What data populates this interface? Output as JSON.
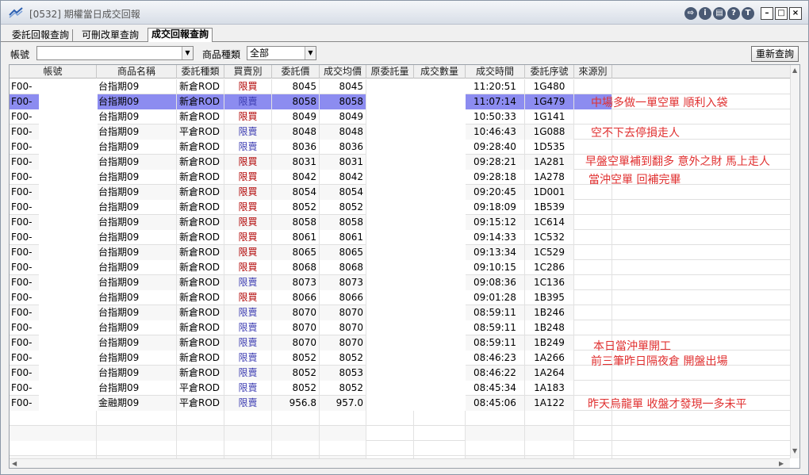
{
  "window": {
    "title": "[0532] 期權當日成交回報"
  },
  "titlebar_buttons": [
    "⇨",
    "i",
    "▤",
    "?",
    "T"
  ],
  "tabs": [
    {
      "label": "委託回報查詢"
    },
    {
      "label": "可刪改單查詢"
    },
    {
      "label": "成交回報查詢"
    }
  ],
  "filters": {
    "account_label": "帳號",
    "account_value": "",
    "product_type_label": "商品種類",
    "product_type_value": "全部",
    "refresh_label": "重新查詢"
  },
  "columns": [
    "帳號",
    "商品名稱",
    "委託種類",
    "買賣別",
    "委託價",
    "成交均價",
    "原委託量",
    "成交數量",
    "成交時間",
    "委託序號",
    "來源別"
  ],
  "rows": [
    {
      "acct": "F00-",
      "name": "台指期09",
      "type": "新倉ROD",
      "side": "限買",
      "price": "8045",
      "avg": "8045",
      "time": "11:20:51",
      "seq": "1G480"
    },
    {
      "acct": "F00-",
      "name": "台指期09",
      "type": "新倉ROD",
      "side": "限賣",
      "price": "8058",
      "avg": "8058",
      "time": "11:07:14",
      "seq": "1G479"
    },
    {
      "acct": "F00-",
      "name": "台指期09",
      "type": "新倉ROD",
      "side": "限買",
      "price": "8049",
      "avg": "8049",
      "time": "10:50:33",
      "seq": "1G141"
    },
    {
      "acct": "F00-",
      "name": "台指期09",
      "type": "平倉ROD",
      "side": "限賣",
      "price": "8048",
      "avg": "8048",
      "time": "10:46:43",
      "seq": "1G088"
    },
    {
      "acct": "F00-",
      "name": "台指期09",
      "type": "新倉ROD",
      "side": "限賣",
      "price": "8036",
      "avg": "8036",
      "time": "09:28:40",
      "seq": "1D535"
    },
    {
      "acct": "F00-",
      "name": "台指期09",
      "type": "新倉ROD",
      "side": "限買",
      "price": "8031",
      "avg": "8031",
      "time": "09:28:21",
      "seq": "1A281"
    },
    {
      "acct": "F00-",
      "name": "台指期09",
      "type": "新倉ROD",
      "side": "限買",
      "price": "8042",
      "avg": "8042",
      "time": "09:28:18",
      "seq": "1A278"
    },
    {
      "acct": "F00-",
      "name": "台指期09",
      "type": "新倉ROD",
      "side": "限買",
      "price": "8054",
      "avg": "8054",
      "time": "09:20:45",
      "seq": "1D001"
    },
    {
      "acct": "F00-",
      "name": "台指期09",
      "type": "新倉ROD",
      "side": "限買",
      "price": "8052",
      "avg": "8052",
      "time": "09:18:09",
      "seq": "1B539"
    },
    {
      "acct": "F00-",
      "name": "台指期09",
      "type": "新倉ROD",
      "side": "限買",
      "price": "8058",
      "avg": "8058",
      "time": "09:15:12",
      "seq": "1C614"
    },
    {
      "acct": "F00-",
      "name": "台指期09",
      "type": "新倉ROD",
      "side": "限買",
      "price": "8061",
      "avg": "8061",
      "time": "09:14:33",
      "seq": "1C532"
    },
    {
      "acct": "F00-",
      "name": "台指期09",
      "type": "新倉ROD",
      "side": "限買",
      "price": "8065",
      "avg": "8065",
      "time": "09:13:34",
      "seq": "1C529"
    },
    {
      "acct": "F00-",
      "name": "台指期09",
      "type": "新倉ROD",
      "side": "限買",
      "price": "8068",
      "avg": "8068",
      "time": "09:10:15",
      "seq": "1C286"
    },
    {
      "acct": "F00-",
      "name": "台指期09",
      "type": "新倉ROD",
      "side": "限賣",
      "price": "8073",
      "avg": "8073",
      "time": "09:08:36",
      "seq": "1C136"
    },
    {
      "acct": "F00-",
      "name": "台指期09",
      "type": "新倉ROD",
      "side": "限買",
      "price": "8066",
      "avg": "8066",
      "time": "09:01:28",
      "seq": "1B395"
    },
    {
      "acct": "F00-",
      "name": "台指期09",
      "type": "新倉ROD",
      "side": "限賣",
      "price": "8070",
      "avg": "8070",
      "time": "08:59:11",
      "seq": "1B246"
    },
    {
      "acct": "F00-",
      "name": "台指期09",
      "type": "新倉ROD",
      "side": "限賣",
      "price": "8070",
      "avg": "8070",
      "time": "08:59:11",
      "seq": "1B248"
    },
    {
      "acct": "F00-",
      "name": "台指期09",
      "type": "新倉ROD",
      "side": "限賣",
      "price": "8070",
      "avg": "8070",
      "time": "08:59:11",
      "seq": "1B249"
    },
    {
      "acct": "F00-",
      "name": "台指期09",
      "type": "新倉ROD",
      "side": "限賣",
      "price": "8052",
      "avg": "8052",
      "time": "08:46:23",
      "seq": "1A266"
    },
    {
      "acct": "F00-",
      "name": "台指期09",
      "type": "新倉ROD",
      "side": "限賣",
      "price": "8052",
      "avg": "8053",
      "time": "08:46:22",
      "seq": "1A264"
    },
    {
      "acct": "F00-",
      "name": "台指期09",
      "type": "平倉ROD",
      "side": "限賣",
      "price": "8052",
      "avg": "8052",
      "time": "08:45:34",
      "seq": "1A183"
    },
    {
      "acct": "F00-",
      "name": "金融期09",
      "type": "平倉ROD",
      "side": "限賣",
      "price": "956.8",
      "avg": "957.0",
      "time": "08:45:06",
      "seq": "1A122"
    }
  ],
  "annotations": [
    {
      "text": "中場多做一單空單 順利入袋",
      "row": 1
    },
    {
      "text": "空不下去停損走人",
      "row": 3
    },
    {
      "text": "早盤空單補到翻多 意外之財 馬上走人",
      "row": 5
    },
    {
      "text": "當沖空單 回補完畢",
      "row": 6
    },
    {
      "text": "本日當沖單開工",
      "row": 17
    },
    {
      "text": "前三筆昨日隔夜倉 開盤出場",
      "row": 18
    },
    {
      "text": "昨天烏龍單 收盤才發現一多未平",
      "row": 21
    }
  ],
  "colors": {
    "buy": "#b00000",
    "sell": "#3a3ab0",
    "selected_row": "#8c8cf0",
    "annotation": "#e03030"
  }
}
